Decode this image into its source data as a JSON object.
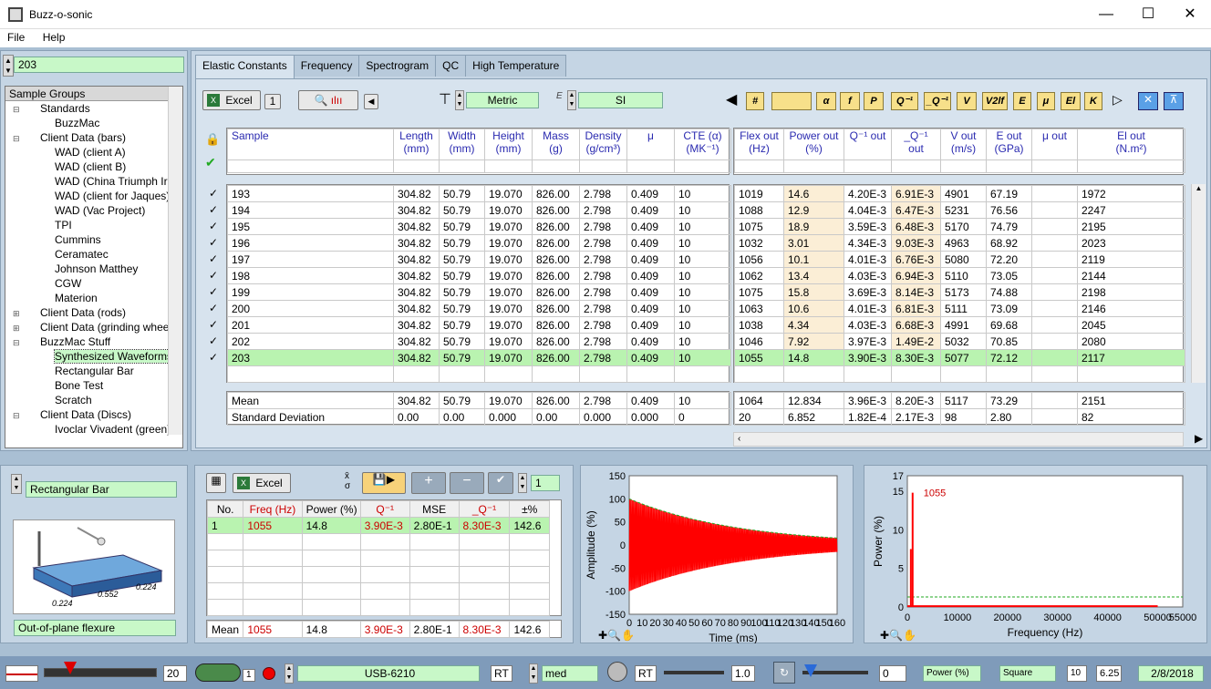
{
  "app": {
    "title": "Buzz-o-sonic",
    "menu": [
      "File",
      "Help"
    ]
  },
  "sample_field": "203",
  "tree": {
    "header": "Sample Groups",
    "items": [
      {
        "label": "Standards",
        "level": 1,
        "exp": "-"
      },
      {
        "label": "BuzzMac",
        "level": 2,
        "exp": ""
      },
      {
        "label": "Client Data (bars)",
        "level": 1,
        "exp": "-"
      },
      {
        "label": "WAD (client A)",
        "level": 2,
        "exp": ""
      },
      {
        "label": "WAD (client B)",
        "level": 2,
        "exp": ""
      },
      {
        "label": "WAD (China Triumph Ir",
        "level": 2,
        "exp": ""
      },
      {
        "label": "WAD (client for Jaques)",
        "level": 2,
        "exp": ""
      },
      {
        "label": "WAD (Vac Project)",
        "level": 2,
        "exp": ""
      },
      {
        "label": "TPI",
        "level": 2,
        "exp": ""
      },
      {
        "label": "Cummins",
        "level": 2,
        "exp": ""
      },
      {
        "label": "Ceramatec",
        "level": 2,
        "exp": ""
      },
      {
        "label": "Johnson Matthey",
        "level": 2,
        "exp": ""
      },
      {
        "label": "CGW",
        "level": 2,
        "exp": ""
      },
      {
        "label": "Materion",
        "level": 2,
        "exp": ""
      },
      {
        "label": "Client Data (rods)",
        "level": 1,
        "exp": "+"
      },
      {
        "label": "Client Data (grinding whee",
        "level": 1,
        "exp": "+"
      },
      {
        "label": "BuzzMac Stuff",
        "level": 1,
        "exp": "-"
      },
      {
        "label": "Synthesized Waveforms",
        "level": 2,
        "exp": "",
        "selected": true
      },
      {
        "label": "Rectangular Bar",
        "level": 2,
        "exp": ""
      },
      {
        "label": "Bone Test",
        "level": 2,
        "exp": ""
      },
      {
        "label": "Scratch",
        "level": 2,
        "exp": ""
      },
      {
        "label": "Client Data (Discs)",
        "level": 1,
        "exp": "-"
      },
      {
        "label": "Ivoclar Vivadent (green)",
        "level": 2,
        "exp": ""
      }
    ]
  },
  "tabs": [
    "Elastic Constants",
    "Frequency",
    "Spectrogram",
    "QC",
    "High Temperature"
  ],
  "toolbar": {
    "excel": "Excel",
    "excel_count": "1",
    "units": "Metric",
    "system": "SI",
    "ybuttons": [
      "#",
      "",
      "α",
      "f",
      "P",
      "Q⁻¹",
      "_Q⁻¹",
      "V",
      "V2lf",
      "E",
      "μ",
      "El",
      "K"
    ]
  },
  "table": {
    "in_headers": [
      "Sample",
      "Length\n(mm)",
      "Width\n(mm)",
      "Height\n(mm)",
      "Mass\n(g)",
      "Density\n(g/cm³)",
      "μ",
      "CTE (α)\n(MK⁻¹)"
    ],
    "out_headers": [
      "Flex out\n(Hz)",
      "Power out\n(%)",
      "Q⁻¹ out",
      "_Q⁻¹ out",
      "V out\n(m/s)",
      "E out\n(GPa)",
      "μ out",
      "El out\n(N.m²)"
    ],
    "rows": [
      [
        "193",
        "304.82",
        "50.79",
        "19.070",
        "826.00",
        "2.798",
        "0.409",
        "10",
        "1019",
        "14.6",
        "4.20E-3",
        "6.91E-3",
        "4901",
        "67.19",
        "",
        "1972"
      ],
      [
        "194",
        "304.82",
        "50.79",
        "19.070",
        "826.00",
        "2.798",
        "0.409",
        "10",
        "1088",
        "12.9",
        "4.04E-3",
        "6.47E-3",
        "5231",
        "76.56",
        "",
        "2247"
      ],
      [
        "195",
        "304.82",
        "50.79",
        "19.070",
        "826.00",
        "2.798",
        "0.409",
        "10",
        "1075",
        "18.9",
        "3.59E-3",
        "6.48E-3",
        "5170",
        "74.79",
        "",
        "2195"
      ],
      [
        "196",
        "304.82",
        "50.79",
        "19.070",
        "826.00",
        "2.798",
        "0.409",
        "10",
        "1032",
        "3.01",
        "4.34E-3",
        "9.03E-3",
        "4963",
        "68.92",
        "",
        "2023"
      ],
      [
        "197",
        "304.82",
        "50.79",
        "19.070",
        "826.00",
        "2.798",
        "0.409",
        "10",
        "1056",
        "10.1",
        "4.01E-3",
        "6.76E-3",
        "5080",
        "72.20",
        "",
        "2119"
      ],
      [
        "198",
        "304.82",
        "50.79",
        "19.070",
        "826.00",
        "2.798",
        "0.409",
        "10",
        "1062",
        "13.4",
        "4.03E-3",
        "6.94E-3",
        "5110",
        "73.05",
        "",
        "2144"
      ],
      [
        "199",
        "304.82",
        "50.79",
        "19.070",
        "826.00",
        "2.798",
        "0.409",
        "10",
        "1075",
        "15.8",
        "3.69E-3",
        "8.14E-3",
        "5173",
        "74.88",
        "",
        "2198"
      ],
      [
        "200",
        "304.82",
        "50.79",
        "19.070",
        "826.00",
        "2.798",
        "0.409",
        "10",
        "1063",
        "10.6",
        "4.01E-3",
        "6.81E-3",
        "5111",
        "73.09",
        "",
        "2146"
      ],
      [
        "201",
        "304.82",
        "50.79",
        "19.070",
        "826.00",
        "2.798",
        "0.409",
        "10",
        "1038",
        "4.34",
        "4.03E-3",
        "6.68E-3",
        "4991",
        "69.68",
        "",
        "2045"
      ],
      [
        "202",
        "304.82",
        "50.79",
        "19.070",
        "826.00",
        "2.798",
        "0.409",
        "10",
        "1046",
        "7.92",
        "3.97E-3",
        "1.49E-2",
        "5032",
        "70.85",
        "",
        "2080"
      ],
      [
        "203",
        "304.82",
        "50.79",
        "19.070",
        "826.00",
        "2.798",
        "0.409",
        "10",
        "1055",
        "14.8",
        "3.90E-3",
        "8.30E-3",
        "5077",
        "72.12",
        "",
        "2117"
      ]
    ],
    "mean": [
      "Mean",
      "304.82",
      "50.79",
      "19.070",
      "826.00",
      "2.798",
      "0.409",
      "10",
      "1064",
      "12.834",
      "3.96E-3",
      "8.20E-3",
      "5117",
      "73.29",
      "",
      "2151"
    ],
    "std": [
      "Standard Deviation",
      "0.00",
      "0.00",
      "0.000",
      "0.00",
      "0.000",
      "0.000",
      "0",
      "20",
      "6.852",
      "1.82E-4",
      "2.17E-3",
      "98",
      "2.80",
      "",
      "82"
    ]
  },
  "specimen": {
    "shape": "Rectangular Bar",
    "mode": "Out-of-plane flexure",
    "dims": [
      "0.224",
      "0.552",
      "0.224"
    ]
  },
  "peaks": {
    "excel": "Excel",
    "count": "1",
    "headers": [
      "No.",
      "Freq (Hz)",
      "Power (%)",
      "Q⁻¹",
      "MSE",
      "_Q⁻¹",
      "±%"
    ],
    "rows": [
      [
        "1",
        "1055",
        "14.8",
        "3.90E-3",
        "2.80E-1",
        "8.30E-3",
        "142.6"
      ]
    ],
    "mean": [
      "Mean",
      "1055",
      "14.8",
      "3.90E-3",
      "2.80E-1",
      "8.30E-3",
      "142.6"
    ]
  },
  "chart_data": [
    {
      "type": "line",
      "ylabel": "Amplitude (%)",
      "xlabel": "Time (ms)",
      "xlim": [
        0,
        160
      ],
      "ylim": [
        -150,
        150
      ],
      "x_ticks": [
        "0",
        "10",
        "20",
        "30",
        "40",
        "50",
        "60",
        "70",
        "80",
        "90",
        "100",
        "110",
        "120",
        "130",
        "140",
        "150",
        "160"
      ],
      "y_ticks": [
        "150",
        "100",
        "50",
        "0",
        "-50",
        "-100",
        "-150"
      ],
      "envelope_start": 100,
      "envelope_end": 15,
      "color": "#ff0000"
    },
    {
      "type": "bar",
      "ylabel": "Power (%)",
      "xlabel": "Frequency (Hz)",
      "xlim": [
        0,
        55000
      ],
      "ylim": [
        0,
        17
      ],
      "x_ticks": [
        "0",
        "10000",
        "20000",
        "30000",
        "40000",
        "50000",
        "55000"
      ],
      "y_ticks": [
        "17",
        "15",
        "10",
        "5",
        "0"
      ],
      "peak_label": "1055",
      "peaks": [
        {
          "x": 1055,
          "y": 14.8
        },
        {
          "x": 700,
          "y": 7.5
        }
      ],
      "threshold": 1.3,
      "color": "#ff0000"
    }
  ],
  "status": {
    "num": "20",
    "num2": "1",
    "device": "USB-6210",
    "rt": "RT",
    "speed": "med",
    "rt2": "RT",
    "gain": "1.0",
    "level": "0",
    "mode": "Power (%)",
    "wave": "Square",
    "n": "10",
    "v": "6.25",
    "date": "2/8/2018"
  }
}
